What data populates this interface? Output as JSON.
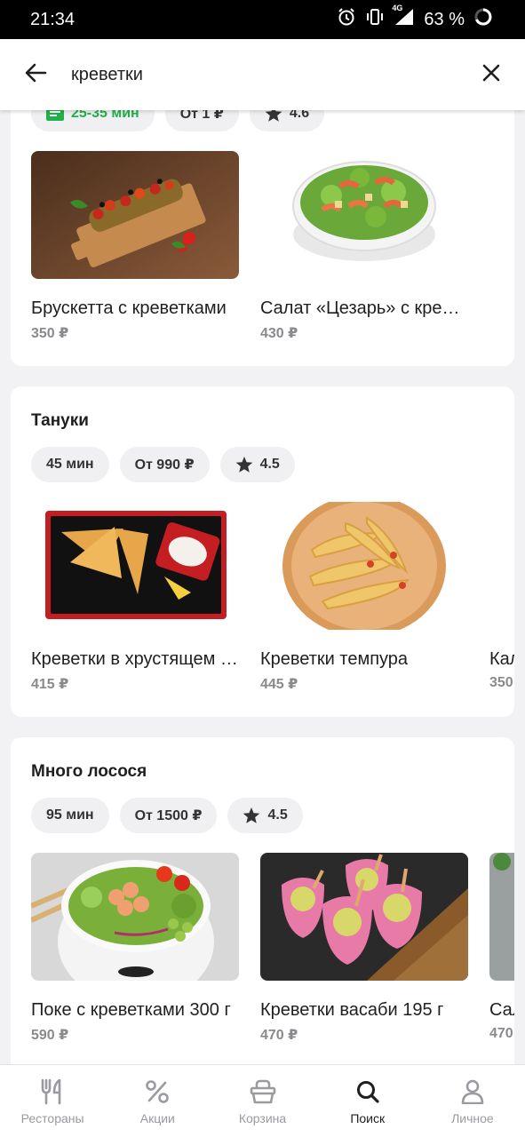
{
  "status_bar": {
    "time": "21:34",
    "network": "4G",
    "battery": "63 %"
  },
  "search": {
    "query": "креветки"
  },
  "restaurants": [
    {
      "name": "",
      "chips": [
        {
          "text": "25-35 мин",
          "icon": "delivery-icon",
          "color": "#21b14a"
        },
        {
          "text": "От 1 ₽"
        },
        {
          "text": "4.6",
          "icon": "star-icon"
        }
      ],
      "dishes": [
        {
          "name": "Брускетта с креветками",
          "price": "350 ₽",
          "image": "bruschetta-image"
        },
        {
          "name": "Салат «Цезарь» с креветками",
          "price": "430 ₽",
          "image": "caesar-salad-image"
        }
      ]
    },
    {
      "name": "Тануки",
      "chips": [
        {
          "text": "45 мин"
        },
        {
          "text": "От 990 ₽"
        },
        {
          "text": "4.5",
          "icon": "star-icon"
        }
      ],
      "dishes": [
        {
          "name": "Креветки в хрустящем тесте",
          "price": "415 ₽",
          "image": "crispy-shrimp-image"
        },
        {
          "name": "Креветки темпура",
          "price": "445 ₽",
          "image": "tempura-image"
        },
        {
          "name": "Кал",
          "price": "350",
          "image": "partial-dish-image"
        }
      ]
    },
    {
      "name": "Много лосося",
      "chips": [
        {
          "text": "95 мин"
        },
        {
          "text": "От 1500 ₽"
        },
        {
          "text": "4.5",
          "icon": "star-icon"
        }
      ],
      "dishes": [
        {
          "name": "Поке с креветками 300 г",
          "price": "590 ₽",
          "image": "poke-image"
        },
        {
          "name": "Креветки васаби 195 г",
          "price": "470 ₽",
          "image": "wasabi-shrimp-image"
        },
        {
          "name": "Сал",
          "price": "470",
          "image": "partial-dish-image"
        }
      ]
    }
  ],
  "bottom_nav": [
    {
      "label": "Рестораны",
      "icon": "fork-knife-icon",
      "active": false
    },
    {
      "label": "Акции",
      "icon": "percent-icon",
      "active": false
    },
    {
      "label": "Корзина",
      "icon": "basket-icon",
      "active": false
    },
    {
      "label": "Поиск",
      "icon": "search-icon",
      "active": true
    },
    {
      "label": "Личное",
      "icon": "person-icon",
      "active": false
    }
  ],
  "colors": {
    "accent_green": "#21b14a",
    "inactive": "#9a9aa0",
    "background": "#f2f2f4"
  }
}
